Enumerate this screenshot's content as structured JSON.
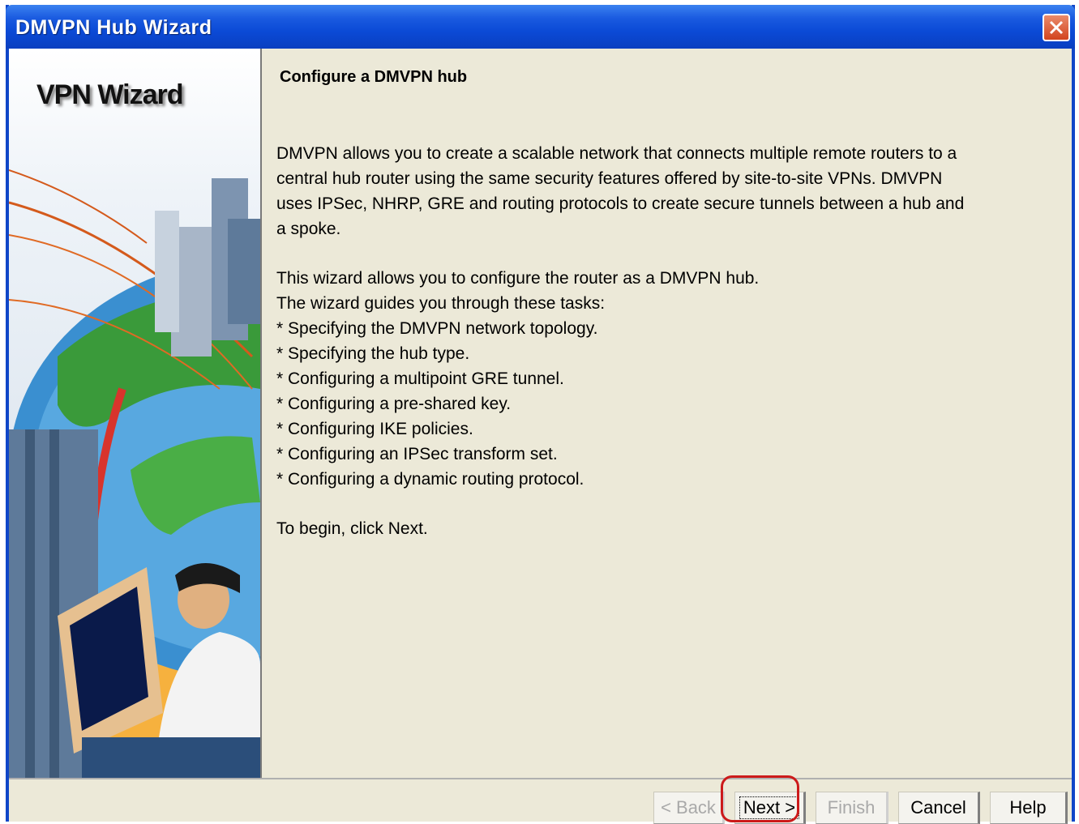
{
  "window": {
    "title": "DMVPN Hub Wizard"
  },
  "sidebar": {
    "title": "VPN Wizard"
  },
  "main": {
    "heading": "Configure a DMVPN hub",
    "intro_lines": [
      "DMVPN allows you to create a scalable network that connects multiple remote routers to a",
      "central hub router using the same security features offered by site-to-site VPNs. DMVPN",
      "uses IPSec, NHRP, GRE and routing protocols to create secure tunnels between a hub and",
      "a spoke."
    ],
    "tasks_intro": [
      "This wizard allows you to configure the router as a DMVPN hub.",
      "The wizard guides you through these tasks:"
    ],
    "tasks": [
      "* Specifying the DMVPN network topology.",
      "* Specifying the hub type.",
      "* Configuring a multipoint GRE tunnel.",
      "* Configuring a pre-shared key.",
      "* Configuring IKE policies.",
      "* Configuring an IPSec transform set.",
      "* Configuring a dynamic routing protocol."
    ],
    "closing": "To begin, click Next."
  },
  "buttons": {
    "back": "< Back",
    "next": "Next >",
    "finish": "Finish",
    "cancel": "Cancel",
    "help": "Help"
  },
  "colors": {
    "titlebar": "#0b4ad6",
    "dialog_bg": "#ece9d8",
    "highlight": "#cc1a1a"
  }
}
